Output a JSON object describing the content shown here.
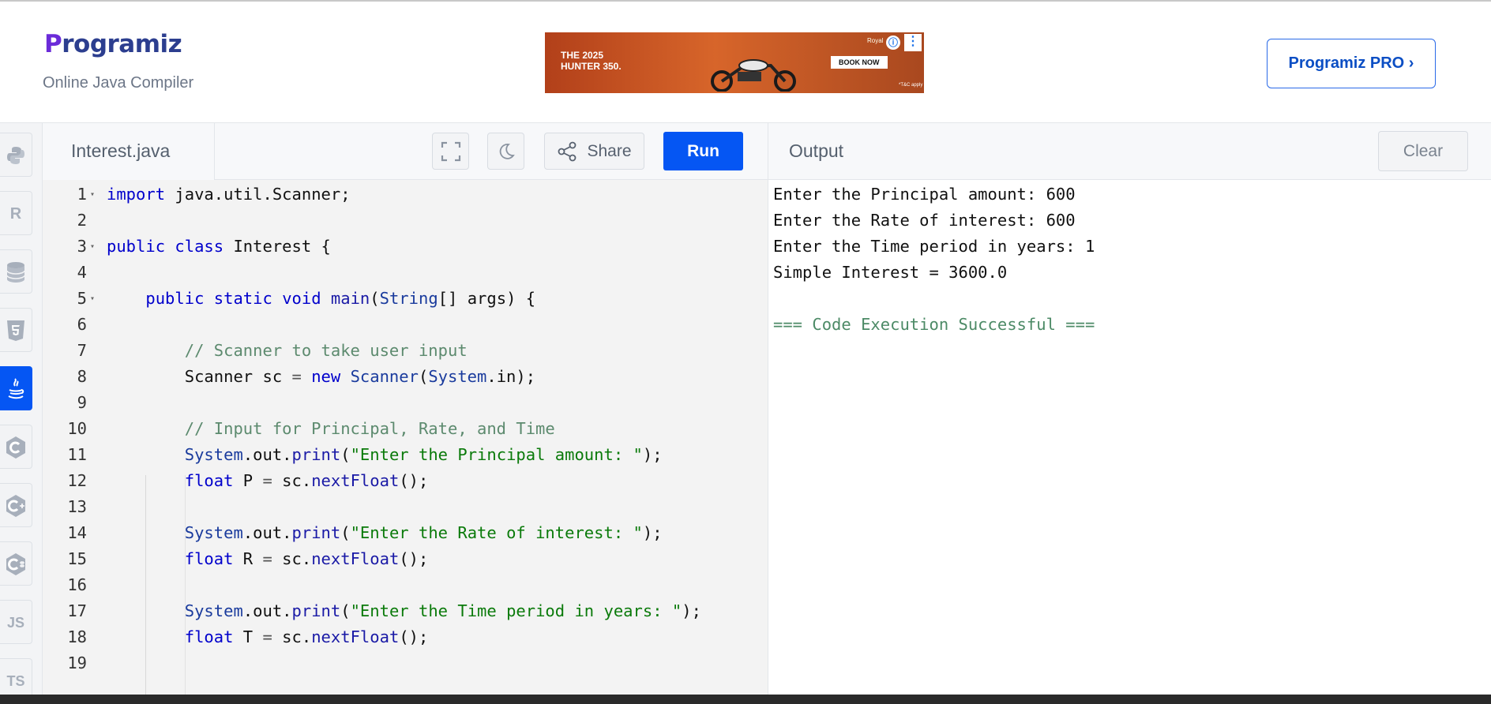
{
  "header": {
    "logo_text_first": "P",
    "logo_text_rest": "rogramiz",
    "subtitle": "Online Java Compiler",
    "pro_button": "Programiz PRO ›"
  },
  "ad": {
    "headline_line1": "THE 2025",
    "headline_line2": "HUNTER 350.",
    "book_now": "BOOK NOW",
    "tag": "Royal",
    "info_icon": "ⓘ",
    "menu_icon": "⋮",
    "tc": "*T&C apply"
  },
  "rail": {
    "items": [
      {
        "name": "python",
        "label": "🐍"
      },
      {
        "name": "r",
        "label": "R"
      },
      {
        "name": "sql",
        "label": "≡"
      },
      {
        "name": "html",
        "label": "5"
      },
      {
        "name": "java",
        "label": "♨"
      },
      {
        "name": "c",
        "label": "C"
      },
      {
        "name": "cpp",
        "label": "C"
      },
      {
        "name": "csharp",
        "label": "C"
      },
      {
        "name": "js",
        "label": "JS"
      },
      {
        "name": "ts",
        "label": "TS"
      }
    ]
  },
  "editor": {
    "filename": "Interest.java",
    "share_label": "Share",
    "run_label": "Run",
    "lines": [
      {
        "n": "1",
        "fold": "▾"
      },
      {
        "n": "2",
        "fold": ""
      },
      {
        "n": "3",
        "fold": "▾"
      },
      {
        "n": "4",
        "fold": ""
      },
      {
        "n": "5",
        "fold": "▾"
      },
      {
        "n": "6",
        "fold": ""
      },
      {
        "n": "7",
        "fold": ""
      },
      {
        "n": "8",
        "fold": ""
      },
      {
        "n": "9",
        "fold": ""
      },
      {
        "n": "10",
        "fold": ""
      },
      {
        "n": "11",
        "fold": ""
      },
      {
        "n": "12",
        "fold": ""
      },
      {
        "n": "13",
        "fold": ""
      },
      {
        "n": "14",
        "fold": ""
      },
      {
        "n": "15",
        "fold": ""
      },
      {
        "n": "16",
        "fold": ""
      },
      {
        "n": "17",
        "fold": ""
      },
      {
        "n": "18",
        "fold": ""
      },
      {
        "n": "19",
        "fold": ""
      }
    ],
    "tokens": {
      "l1": [
        "import",
        " java.util.Scanner;"
      ],
      "l3": [
        "public",
        " ",
        "class",
        " Interest {"
      ],
      "l5": [
        "    ",
        "public",
        " ",
        "static",
        " ",
        "void",
        " ",
        "main",
        "(",
        "String",
        "[] args) {"
      ],
      "l7": "        // Scanner to take user input",
      "l8": [
        "        Scanner sc ",
        "=",
        " ",
        "new",
        " ",
        "Scanner",
        "(",
        "System",
        ".in);"
      ],
      "l10": "        // Input for Principal, Rate, and Time",
      "l11": [
        "        ",
        "System",
        ".out.",
        "print",
        "(",
        "\"Enter the Principal amount: \"",
        ");"
      ],
      "l12": [
        "        ",
        "float",
        " P ",
        "=",
        " sc.",
        "nextFloat",
        "();"
      ],
      "l14": [
        "        ",
        "System",
        ".out.",
        "print",
        "(",
        "\"Enter the Rate of interest: \"",
        ");"
      ],
      "l15": [
        "        ",
        "float",
        " R ",
        "=",
        " sc.",
        "nextFloat",
        "();"
      ],
      "l17": [
        "        ",
        "System",
        ".out.",
        "print",
        "(",
        "\"Enter the Time period in years: \"",
        ");"
      ],
      "l18": [
        "        ",
        "float",
        " T ",
        "=",
        " sc.",
        "nextFloat",
        "();"
      ]
    }
  },
  "output": {
    "title": "Output",
    "clear_label": "Clear",
    "lines": [
      "Enter the Principal amount: 600",
      "Enter the Rate of interest: 600",
      "Enter the Time period in years: 1",
      "Simple Interest = 3600.0",
      "",
      "=== Code Execution Successful ==="
    ]
  }
}
